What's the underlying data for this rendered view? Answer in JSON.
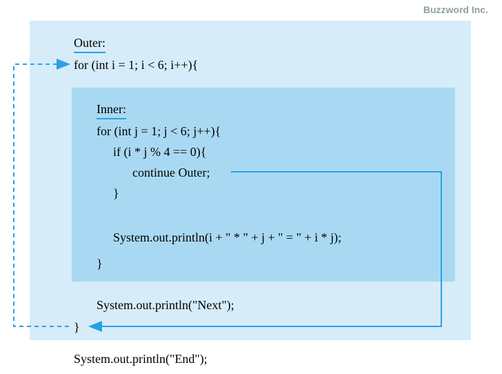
{
  "brand": "Buzzword Inc.",
  "outer": {
    "title": "Outer:",
    "for_line": "for (int i = 1; i < 6; i++){",
    "close": "}"
  },
  "inner": {
    "title": "Inner:",
    "for_line": "for (int j = 1; j < 6; j++){",
    "if_line": "if (i * j % 4 == 0){",
    "continue_line": "continue Outer;",
    "if_close": "}",
    "println": "System.out.println(i + \" * \" + j + \" = \" + i * j);",
    "for_close": "}"
  },
  "after_inner": "System.out.println(\"Next\");",
  "after_outer": "System.out.println(\"End\");",
  "colors": {
    "outer_bg": "#d6ecf9",
    "inner_bg": "#a9d9f2",
    "line": "#2aa0e6"
  }
}
